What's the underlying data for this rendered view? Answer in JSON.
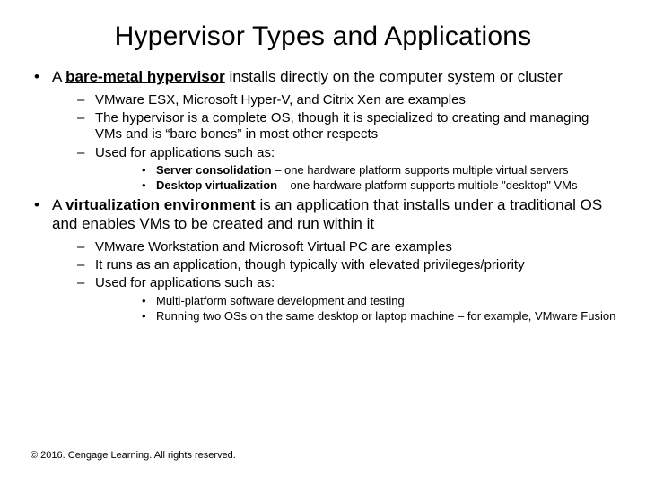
{
  "title": "Hypervisor Types and Applications",
  "b1": {
    "prefix": "A ",
    "term": "bare-metal hypervisor",
    "rest": " installs directly on the computer system or cluster",
    "s1": "VMware ESX, Microsoft Hyper-V, and Citrix Xen are examples",
    "s2": "The hypervisor is a complete OS, though it is specialized to creating and managing VMs and is “bare bones” in most other respects",
    "s3": "Used for applications such as:",
    "a1_bold": "Server consolidation",
    "a1_rest": " – one hardware platform supports multiple virtual servers",
    "a2_bold": "Desktop virtualization",
    "a2_rest": " – one hardware platform supports multiple \"desktop\" VMs"
  },
  "b2": {
    "prefix": "A ",
    "term": "virtualization environment",
    "rest": " is an application that installs under a traditional OS and enables VMs to be created and run within it",
    "s1": "VMware Workstation and Microsoft Virtual PC are examples",
    "s2": "It runs as an application, though typically with elevated privileges/priority",
    "s3": "Used for applications such as:",
    "a1": "Multi-platform software development and testing",
    "a2": "Running two OSs on the same desktop or laptop machine – for example, VMware Fusion"
  },
  "footer": "© 2016. Cengage Learning. All rights reserved."
}
